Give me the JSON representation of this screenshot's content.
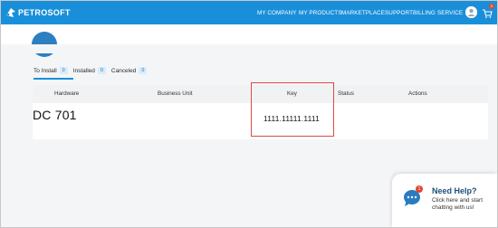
{
  "app": {
    "logo_text": "PETROSOFT"
  },
  "nav": {
    "items": [
      "MY COMPANY",
      "MY PRODUCTS",
      "MARKETPLACE",
      "SUPPORT",
      "BILLING",
      "SERVICE"
    ],
    "cart_badge": "0"
  },
  "tabs": [
    {
      "label": "To Install",
      "count": "0",
      "active": true
    },
    {
      "label": "Installed",
      "count": "0",
      "active": false
    },
    {
      "label": "Canceled",
      "count": "0",
      "active": false
    }
  ],
  "table": {
    "headers": [
      "Hardware",
      "Business Unit",
      "Key",
      "Status",
      "Actions"
    ],
    "rows": [
      {
        "hardware": "DC 701",
        "business_unit": "",
        "key": "1111.11111.1111",
        "status": "",
        "actions": ""
      }
    ]
  },
  "help": {
    "title": "Need Help?",
    "text": "Click here and start chatting with us!",
    "badge": "1"
  },
  "colors": {
    "topbar": "#1a8fd9",
    "highlight": "#e04848",
    "help_title": "#1d4f7a"
  },
  "icons": [
    "petrosoft-logo-icon",
    "user-avatar-icon",
    "cart-icon",
    "chat-bubble-icon"
  ]
}
